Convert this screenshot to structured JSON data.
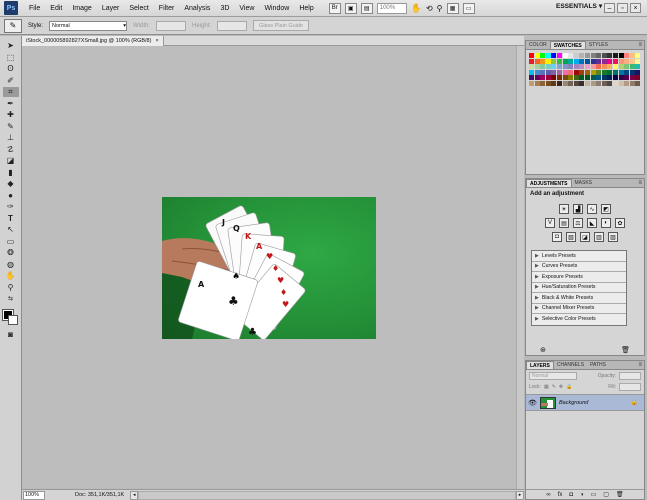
{
  "menubar": {
    "logo": "Ps",
    "items": [
      "File",
      "Edit",
      "Image",
      "Layer",
      "Select",
      "Filter",
      "Analysis",
      "3D",
      "View",
      "Window",
      "Help"
    ],
    "zoom": "100%",
    "workspace": "ESSENTIALS"
  },
  "options": {
    "style_label": "Style:",
    "style_value": "Normal",
    "width_label": "Width:",
    "height_label": "Height:",
    "refine_button": "Glass Plain Guide"
  },
  "document": {
    "tab_title": "iStock_000005892827XSmall.jpg @ 100% (RGB/8)",
    "zoom": "100%",
    "doc_info": "Doc: 351,1K/351,1K"
  },
  "swatches_panel": {
    "tabs": [
      "COLOR",
      "SWATCHES",
      "STYLES"
    ],
    "colors": [
      "#ff0000",
      "#ffff00",
      "#00ff00",
      "#00ffff",
      "#0000ff",
      "#ff00ff",
      "#ffffff",
      "#e6e6e6",
      "#cccccc",
      "#b3b3b3",
      "#999999",
      "#808080",
      "#666666",
      "#4d4d4d",
      "#333333",
      "#1a1a1a",
      "#000000",
      "#ff7f7f",
      "#ffbf7f",
      "#ffff7f",
      "#ed1c24",
      "#f26522",
      "#f7941d",
      "#fff200",
      "#8dc63f",
      "#39b54a",
      "#00a651",
      "#00a99d",
      "#00aeef",
      "#0072bc",
      "#0054a6",
      "#2e3192",
      "#662d91",
      "#92278f",
      "#ec008c",
      "#ed145b",
      "#f69679",
      "#f9ad81",
      "#fdc689",
      "#fff799",
      "#c4df9b",
      "#a3d39c",
      "#82ca9c",
      "#7accc8",
      "#6dcff6",
      "#7da7d9",
      "#8393ca",
      "#8781bd",
      "#a186be",
      "#bd8cbf",
      "#f49ac1",
      "#f5989d",
      "#f26c4f",
      "#f68e56",
      "#fbaf5d",
      "#fff568",
      "#acd373",
      "#7cc576",
      "#3cb878",
      "#1cbbb4",
      "#00bff3",
      "#448ccb",
      "#5674b9",
      "#605ca8",
      "#855fa8",
      "#a763a8",
      "#f06eaa",
      "#f26d7d",
      "#9e0b0f",
      "#a0410d",
      "#a36209",
      "#aba000",
      "#598527",
      "#197b30",
      "#007236",
      "#00746b",
      "#0076a3",
      "#004a80",
      "#003471",
      "#1b1464",
      "#440e62",
      "#630460",
      "#9e005d",
      "#9e0039",
      "#790000",
      "#7b2e00",
      "#7d4900",
      "#827b00",
      "#406618",
      "#005e20",
      "#005826",
      "#005952",
      "#005b7f",
      "#003663",
      "#002157",
      "#0d004c",
      "#32004b",
      "#4b0049",
      "#7b0046",
      "#7a0026",
      "#c69c6d",
      "#a67c52",
      "#8c6239",
      "#754c24",
      "#603913",
      "#3c2415",
      "#998675",
      "#736357",
      "#534741",
      "#362f2d",
      "#c7b299",
      "#aa9b84",
      "#8c7b70",
      "#6d5f56",
      "#504a45",
      "#e5d4c0",
      "#d1bfa7",
      "#b39c85",
      "#8f7b68",
      "#6b5a4b"
    ]
  },
  "adjustments_panel": {
    "tabs": [
      "ADJUSTMENTS",
      "MASKS"
    ],
    "title": "Add an adjustment",
    "presets": [
      "Levels Presets",
      "Curves Presets",
      "Exposure Presets",
      "Hue/Saturation Presets",
      "Black & White Presets",
      "Channel Mixer Presets",
      "Selective Color Presets"
    ]
  },
  "layers_panel": {
    "tabs": [
      "LAYERS",
      "CHANNELS",
      "PATHS"
    ],
    "blend_mode": "Normal",
    "opacity_label": "Opacity:",
    "lock_label": "Lock:",
    "fill_label": "Fill:",
    "layer_name": "Background"
  }
}
